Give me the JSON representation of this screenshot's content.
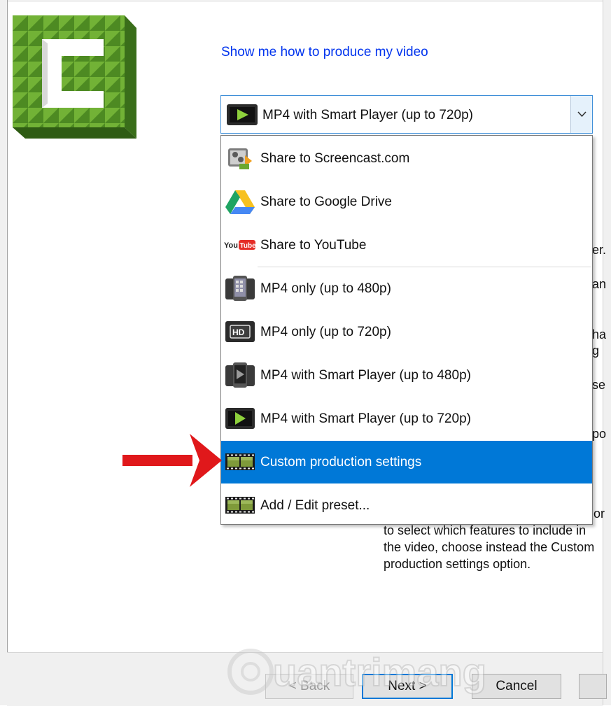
{
  "help_link": "Show me how to produce my video",
  "combo": {
    "selected": "MP4 with Smart Player (up to 720p)"
  },
  "dropdown": {
    "items": [
      {
        "label": "Share to Screencast.com",
        "icon": "screencast-icon"
      },
      {
        "label": "Share to Google Drive",
        "icon": "google-drive-icon"
      },
      {
        "label": "Share to YouTube",
        "icon": "youtube-icon"
      },
      {
        "label": "MP4 only (up to 480p)",
        "icon": "phone-video-icon"
      },
      {
        "label": "MP4 only (up to 720p)",
        "icon": "hd-icon"
      },
      {
        "label": "MP4 with Smart Player (up to 480p)",
        "icon": "phone-player-icon"
      },
      {
        "label": "MP4 with Smart Player (up to 720p)",
        "icon": "play-icon"
      },
      {
        "label": "Custom production settings",
        "icon": "film-strip-icon",
        "selected": true
      },
      {
        "label": "Add / Edit preset...",
        "icon": "film-strip-icon"
      }
    ]
  },
  "description": {
    "lines": [
      "or",
      "to select which features to include in",
      "the video, choose instead the Custom",
      "production settings option."
    ],
    "fragments": [
      "er.",
      "an",
      "han",
      "g",
      "ser",
      "pot"
    ]
  },
  "buttons": {
    "back": "< Back",
    "next": "Next >",
    "cancel": "Cancel"
  },
  "watermark": "uantrimang",
  "colors": {
    "selection": "#0078d7",
    "link": "#0033ee",
    "arrow": "#e0181b",
    "logo_green": "#5a9a2a"
  }
}
